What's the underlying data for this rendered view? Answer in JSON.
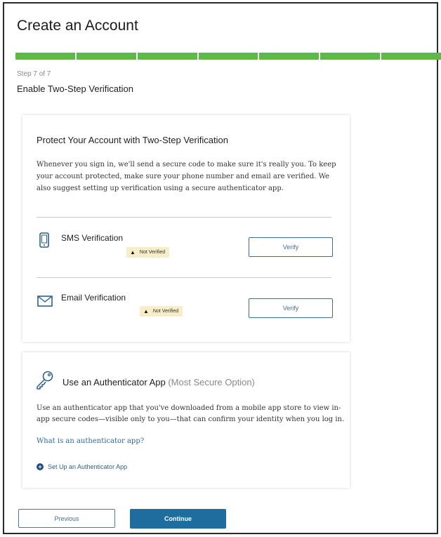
{
  "page": {
    "title": "Create an Account",
    "progress": {
      "current_step": 7,
      "total_steps": 7,
      "segments": 7,
      "color": "#5fb947"
    },
    "step_label": "Step 7 of 7",
    "step_title": "Enable Two-Step Verification"
  },
  "two_step_card": {
    "heading": "Protect Your Account with Two-Step Verification",
    "description": "Whenever you sign in, we'll send a secure code to make sure it's really you. To keep your account protected, make sure your phone number and email are verified. We also suggest setting up verification using a secure authenticator app.",
    "sms": {
      "icon": "phone-icon",
      "label": "SMS Verification",
      "status": "Not Verified",
      "button_label": "Verify"
    },
    "email": {
      "icon": "envelope-icon",
      "label": "Email Verification",
      "status": "Not Verified",
      "button_label": "Verify"
    }
  },
  "authenticator_card": {
    "icon": "key-icon",
    "title": "Use an Authenticator App",
    "title_note": "(Most Secure Option)",
    "description": "Use an authenticator app that you've downloaded from a mobile app store to view in-app secure codes—visible only to you—that can confirm your identity when you log in.",
    "help_link": "What is an authenticator app?",
    "setup_label": "Set Up an Authenticator App"
  },
  "footer": {
    "previous_label": "Previous",
    "continue_label": "Continue",
    "accent_color": "#1f6d9e"
  }
}
